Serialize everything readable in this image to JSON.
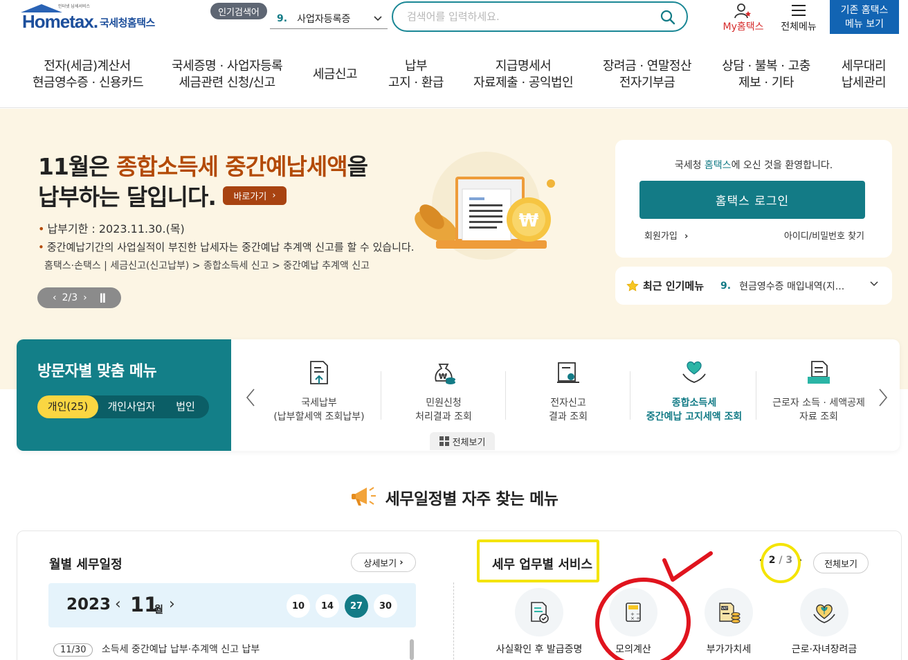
{
  "header": {
    "logo_word": "Hometax.",
    "logo_kor": "국세청홈택스",
    "logo_tagline": "인터넷 납세서비스",
    "popular_badge": "인기검색어",
    "popular_num": "9.",
    "popular_value": "사업자등록증",
    "search_placeholder": "검색어를 입력하세요.",
    "myhome": "My홈택스",
    "allmenu": "전체메뉴",
    "oldhome_line1": "기존 홈택스",
    "oldhome_line2": "메뉴 보기"
  },
  "gnb": [
    {
      "l1": "전자(세금)계산서",
      "l2": "현금영수증 · 신용카드"
    },
    {
      "l1": "국세증명 · 사업자등록",
      "l2": "세금관련 신청/신고"
    },
    {
      "l1": "세금신고",
      "l2": ""
    },
    {
      "l1": "납부",
      "l2": "고지 · 환급"
    },
    {
      "l1": "지급명세서",
      "l2": "자료제출 · 공익법인"
    },
    {
      "l1": "장려금 · 연말정산",
      "l2": "전자기부금"
    },
    {
      "l1": "상담 · 불복 · 고충",
      "l2": "제보 · 기타"
    },
    {
      "l1": "세무대리",
      "l2": "납세관리"
    }
  ],
  "hero": {
    "title_a": "11월은 ",
    "title_hl": "종합소득세 중간예납세액",
    "title_b": "을",
    "title_line2": "납부하는 달입니다.",
    "goto": "바로가기",
    "deadline": "납부기한 : 2023.11.30.(목)",
    "note": "중간예납기간의 사업실적이 부진한 납세자는 중간예납 추계액 신고를 할 수 있습니다.",
    "path": "홈택스·손택스 | 세금신고(신고납부) > 종합소득세 신고 > 중간예납 추계액 신고",
    "pager": "2/3"
  },
  "login": {
    "welcome_a": "국세청 ",
    "welcome_hl": "홈택스",
    "welcome_b": "에 오신 것을 환영합니다.",
    "login_button": "홈택스 로그인",
    "join": "회원가입",
    "find": "아이디/비밀번호 찾기"
  },
  "recent": {
    "title": "최근 인기메뉴",
    "num": "9.",
    "value": "현금영수증 매입내역(지..."
  },
  "visitor": {
    "title": "방문자별 맞춤 메뉴",
    "tabs": [
      "개인(25)",
      "개인사업자",
      "법인"
    ],
    "items": [
      {
        "l1": "국세납부",
        "l2": "(납부할세액 조회납부)"
      },
      {
        "l1": "민원신청",
        "l2": "처리결과 조회"
      },
      {
        "l1": "전자신고",
        "l2": "결과 조회"
      },
      {
        "l1": "종합소득세",
        "l2": "중간예납 고지세액 조회"
      },
      {
        "l1": "근로자 소득 · 세액공제",
        "l2": "자료 조회"
      }
    ],
    "view_all": "전체보기"
  },
  "schedule": {
    "section_title": "세무일정별 자주 찾는 메뉴",
    "monthly_title": "월별 세무일정",
    "detail": "상세보기",
    "year": "2023",
    "month": "11",
    "month_unit": "월",
    "days": [
      "10",
      "14",
      "27",
      "30"
    ],
    "selected_day": "27",
    "item_date": "11/30",
    "item_text": "소득세 중간예납 납부·추계액 신고 납부"
  },
  "services": {
    "title": "세무 업무별 서비스",
    "page_current": "2",
    "page_total": "3",
    "view_all": "전체보기",
    "items": [
      "사실확인 후 발급증명",
      "모의계산",
      "부가가치세",
      "근로·자녀장려금"
    ]
  },
  "colors": {
    "teal": "#137b86",
    "blue": "#1264b3",
    "hero_bg": "#fcf5e4",
    "highlight_yellow": "#f4e400",
    "mark_red": "#e0141e"
  }
}
